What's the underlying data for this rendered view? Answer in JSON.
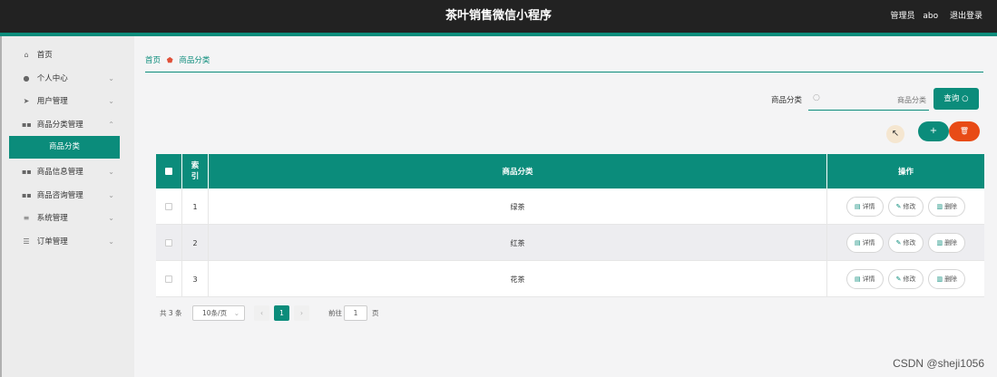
{
  "header": {
    "title": "茶叶销售微信小程序",
    "user_role": "管理员",
    "user_name": "abo",
    "logout": "退出登录"
  },
  "sidebar": {
    "items": [
      {
        "label": "首页",
        "icon": "home-icon",
        "glyph": "⌂",
        "chevron": false
      },
      {
        "label": "个人中心",
        "icon": "user-icon",
        "glyph": "●",
        "chevron": true
      },
      {
        "label": "用户管理",
        "icon": "send-icon",
        "glyph": "➤",
        "chevron": true
      },
      {
        "label": "商品分类管理",
        "icon": "grid-icon",
        "glyph": "▪▪",
        "chevron": true
      },
      {
        "label": "商品信息管理",
        "icon": "grid-icon",
        "glyph": "▪▪",
        "chevron": true
      },
      {
        "label": "商品咨询管理",
        "icon": "grid-icon",
        "glyph": "▪▪",
        "chevron": true
      },
      {
        "label": "系统管理",
        "icon": "system-icon",
        "glyph": "≡",
        "chevron": true
      },
      {
        "label": "订单管理",
        "icon": "list-icon",
        "glyph": "☰",
        "chevron": true
      }
    ],
    "active_sub": "商品分类"
  },
  "breadcrumb": {
    "home": "首页",
    "current": "商品分类"
  },
  "search": {
    "label": "商品分类",
    "placeholder": "商品分类",
    "button": "查询"
  },
  "actions": {
    "add": "+",
    "delete": "🗑"
  },
  "table": {
    "headers": {
      "index": "索引",
      "name": "商品分类",
      "ops": "操作"
    },
    "rows": [
      {
        "index": "1",
        "name": "绿茶"
      },
      {
        "index": "2",
        "name": "红茶"
      },
      {
        "index": "3",
        "name": "花茶"
      }
    ],
    "row_ops": {
      "detail": "详情",
      "edit": "修改",
      "delete": "删除"
    }
  },
  "pagination": {
    "total": "共 3 条",
    "page_size": "10条/页",
    "current_page": "1",
    "goto_label": "前往",
    "goto_value": "1",
    "goto_unit": "页"
  },
  "watermark": "CSDN @sheji1056",
  "colors": {
    "accent": "#0b8c7b",
    "danger": "#e84b16",
    "topbar": "#222222"
  }
}
